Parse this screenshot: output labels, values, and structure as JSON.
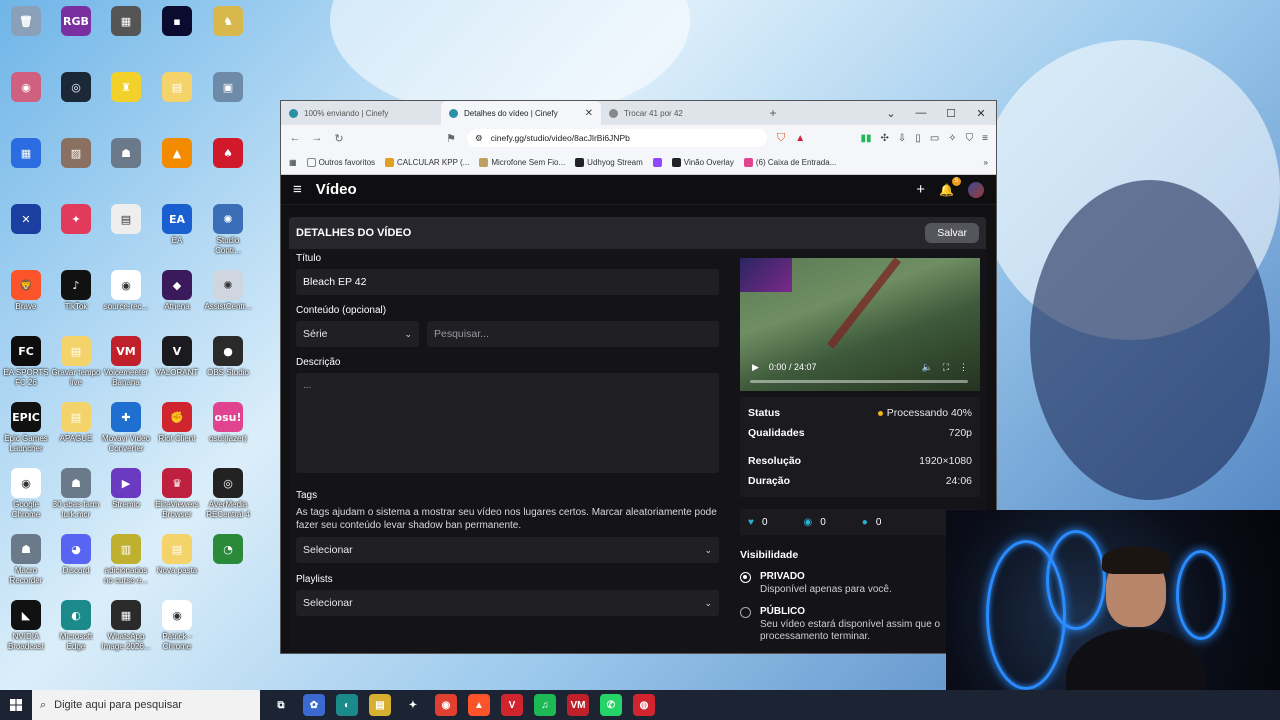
{
  "desktop": {
    "icons": [
      {
        "label": "",
        "color": "#8aa0b8",
        "glyph": "🗑"
      },
      {
        "label": "",
        "color": "#7a2fa0",
        "glyph": "RGB"
      },
      {
        "label": "",
        "color": "#555555",
        "glyph": "▦"
      },
      {
        "label": "",
        "color": "#0b0b30",
        "glyph": "▪"
      },
      {
        "label": "",
        "color": "#d8b84a",
        "glyph": "♞"
      },
      {
        "label": "",
        "color": "#d06080",
        "glyph": "◉"
      },
      {
        "label": "",
        "color": "#1b2838",
        "glyph": "◎"
      },
      {
        "label": "",
        "color": "#f2d12a",
        "glyph": "♜"
      },
      {
        "label": "",
        "color": "#f4d36b",
        "glyph": "▤"
      },
      {
        "label": "",
        "color": "#6d8aa8",
        "glyph": "▣"
      },
      {
        "label": "",
        "color": "#2b6de0",
        "glyph": "▦"
      },
      {
        "label": "",
        "color": "#8a7060",
        "glyph": "▨"
      },
      {
        "label": "",
        "color": "#6a7a8a",
        "glyph": "☗"
      },
      {
        "label": "",
        "color": "#f28b00",
        "glyph": "▲"
      },
      {
        "label": "",
        "color": "#d01a2b",
        "glyph": "♠"
      },
      {
        "label": "",
        "color": "#1a3fa0",
        "glyph": "✕"
      },
      {
        "label": "",
        "color": "#e23a5b",
        "glyph": "✦"
      },
      {
        "label": "",
        "color": "#eeeeee",
        "glyph": "▤"
      },
      {
        "label": "EA",
        "color": "#1a5fd0",
        "glyph": "EA"
      },
      {
        "label": "Studio Contr...",
        "color": "#3a6fb8",
        "glyph": "✺"
      },
      {
        "label": "Brave",
        "color": "#fb542b",
        "glyph": "🦁"
      },
      {
        "label": "TikTok",
        "color": "#111111",
        "glyph": "♪"
      },
      {
        "label": "source-rec...",
        "color": "#ffffff",
        "glyph": "◉"
      },
      {
        "label": "Athena",
        "color": "#3a1a5a",
        "glyph": "◆"
      },
      {
        "label": "AssistCentr...",
        "color": "#d0d6e0",
        "glyph": "✺"
      },
      {
        "label": "EA SPORTS FC 26",
        "color": "#0d0d0d",
        "glyph": "FC"
      },
      {
        "label": "Gravar tempo live",
        "color": "#f4d36b",
        "glyph": "▤"
      },
      {
        "label": "Voicemeeter Banana",
        "color": "#c0202a",
        "glyph": "VM"
      },
      {
        "label": "VALORANT",
        "color": "#1b1b1f",
        "glyph": "V"
      },
      {
        "label": "OBS Studio",
        "color": "#2a2a2a",
        "glyph": "●"
      },
      {
        "label": "Epic Games Launcher",
        "color": "#111111",
        "glyph": "EPIC"
      },
      {
        "label": "APAGUE",
        "color": "#f4d36b",
        "glyph": "▤"
      },
      {
        "label": "Movavi Video Converter",
        "color": "#1e6fd0",
        "glyph": "✚"
      },
      {
        "label": "Riot Client",
        "color": "#d0242e",
        "glyph": "✊"
      },
      {
        "label": "osu!(lazer)",
        "color": "#e0438f",
        "glyph": "osu!"
      },
      {
        "label": "Google Chrome",
        "color": "#ffffff",
        "glyph": "◉"
      },
      {
        "label": "30 abas farm lurk.mcr",
        "color": "#6a7a8a",
        "glyph": "☗"
      },
      {
        "label": "Stremio",
        "color": "#6a3ac0",
        "glyph": "▶"
      },
      {
        "label": "EliteViewers Browser",
        "color": "#c02040",
        "glyph": "♛"
      },
      {
        "label": "AVerMedia RECentral 4",
        "color": "#222222",
        "glyph": "◎"
      },
      {
        "label": "Macro Recorder",
        "color": "#6a7a8a",
        "glyph": "☗"
      },
      {
        "label": "Discord",
        "color": "#5865f2",
        "glyph": "◕"
      },
      {
        "label": "adicionados no curso e...",
        "color": "#c0b030",
        "glyph": "▥"
      },
      {
        "label": "Nova pasta",
        "color": "#f4d36b",
        "glyph": "▤"
      },
      {
        "label": "",
        "color": "#2a8a3a",
        "glyph": "◔"
      },
      {
        "label": "NVIDIA Broadcast",
        "color": "#111111",
        "glyph": "◣"
      },
      {
        "label": "Microsoft Edge",
        "color": "#1a8a8a",
        "glyph": "◐"
      },
      {
        "label": "WhatsApp Image 2026...",
        "color": "#2a2a2a",
        "glyph": "▦"
      },
      {
        "label": "Patrick - Chrome",
        "color": "#ffffff",
        "glyph": "◉"
      }
    ]
  },
  "taskbar": {
    "search_placeholder": "Digite aqui para pesquisar",
    "apps": [
      {
        "name": "task-view",
        "color": "#1c2333",
        "glyph": "⧉"
      },
      {
        "name": "copilot",
        "color": "#3a6ad0",
        "glyph": "✿"
      },
      {
        "name": "edge",
        "color": "#1a8a8a",
        "glyph": "◐"
      },
      {
        "name": "explorer",
        "color": "#d8b030",
        "glyph": "▤"
      },
      {
        "name": "app",
        "color": "#1c2333",
        "glyph": "✦"
      },
      {
        "name": "chrome",
        "color": "#e04030",
        "glyph": "◉"
      },
      {
        "name": "brave",
        "color": "#fb542b",
        "glyph": "▲"
      },
      {
        "name": "vivaldi",
        "color": "#d0242e",
        "glyph": "V"
      },
      {
        "name": "spotify",
        "color": "#1db954",
        "glyph": "♫"
      },
      {
        "name": "voicemeeter",
        "color": "#c0202a",
        "glyph": "VM"
      },
      {
        "name": "whatsapp",
        "color": "#25d366",
        "glyph": "✆"
      },
      {
        "name": "app2",
        "color": "#d0242e",
        "glyph": "◍"
      }
    ]
  },
  "browser": {
    "tabs": [
      {
        "title": "100% enviando | Cinefy",
        "active": false
      },
      {
        "title": "Detalhes do vídeo | Cinefy",
        "active": true
      },
      {
        "title": "Trocar 41 por 42",
        "active": false
      }
    ],
    "url": "cinefy.gg/studio/video/8acJlrBi6JNPb",
    "bookmarks": [
      {
        "label": "Outros favoritos",
        "color": "#888888"
      },
      {
        "label": "CALCULAR KPP (...",
        "color": "#e0a020"
      },
      {
        "label": "Microfone Sem Fio...",
        "color": "#c0a060"
      },
      {
        "label": "Udhyog Stream",
        "color": "#222222"
      },
      {
        "label": "",
        "color": "#9146ff"
      },
      {
        "label": "Vinão Overlay",
        "color": "#222222"
      },
      {
        "label": "(6) Caixa de Entrada...",
        "color": "#e0438f"
      }
    ]
  },
  "app": {
    "page_title": "Vídeo",
    "notification_count": "5",
    "panel_title": "DETALHES DO VÍDEO",
    "save_label": "Salvar",
    "title_label": "Título",
    "title_value": "Bleach EP 42",
    "content_label": "Conteúdo (opcional)",
    "content_type": "Série",
    "search_placeholder": "Pesquisar...",
    "description_label": "Descrição",
    "description_placeholder": "...",
    "tags_label": "Tags",
    "tags_help": "As tags ajudam o sistema a mostrar seu vídeo nos lugares certos. Marcar aleatoriamente pode fazer seu conteúdo levar shadow ban permanente.",
    "tags_select": "Selecionar",
    "playlists_label": "Playlists",
    "playlists_select": "Selecionar",
    "video": {
      "time": "0:00 / 24:07"
    },
    "info": {
      "status_label": "Status",
      "status_value": "Processando 40%",
      "status_color": "#f2b31d",
      "qualities_label": "Qualidades",
      "qualities_value": "720p",
      "resolution_label": "Resolução",
      "resolution_value": "1920×1080",
      "duration_label": "Duração",
      "duration_value": "24:06"
    },
    "stats": {
      "likes": "0",
      "views": "0",
      "comments": "0"
    },
    "visibility": {
      "title": "Visibilidade",
      "private_label": "PRIVADO",
      "private_desc": "Disponível apenas para você.",
      "public_label": "PÚBLICO",
      "public_desc": "Seu vídeo estará disponível assim que o processamento terminar."
    }
  }
}
